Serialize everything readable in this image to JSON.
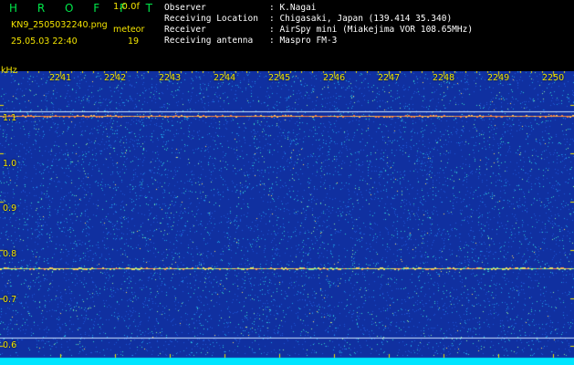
{
  "header": {
    "title": "H R O F F T",
    "version": "1.0.0f",
    "filename": "KN9_2505032240.png",
    "datetime": "25.05.03 22:40",
    "meteor_label": "meteor",
    "meteor_count": "19"
  },
  "info": {
    "rows": [
      {
        "label": "Observer",
        "value": ": K.Nagai"
      },
      {
        "label": "Receiving Location",
        "value": ": Chigasaki, Japan (139.414 35.340)"
      },
      {
        "label": "Receiver",
        "value": ": AirSpy mini (Miakejima VOR 108.65MHz)"
      },
      {
        "label": "Receiving antenna",
        "value": ": Maspro FM-3"
      }
    ]
  },
  "spectrogram": {
    "unit": "kHz",
    "time_ticks": [
      "2241",
      "2242",
      "2243",
      "2244",
      "2245",
      "2246",
      "2247",
      "2248",
      "2249",
      "2250"
    ],
    "freq_ticks": [
      "1.1",
      "1.0",
      "0.9",
      "0.8",
      "0.7",
      "0.6"
    ],
    "ylim": [
      0.58,
      1.17
    ],
    "lines": [
      {
        "freq": 1.087,
        "color": "#cfe6ff"
      },
      {
        "freq": 1.077,
        "color": "#ff9a40"
      },
      {
        "freq": 0.762,
        "color": "#e8e060"
      },
      {
        "freq": 0.618,
        "color": "#cfe6ff"
      }
    ],
    "colors": {
      "background": "#1030a0",
      "baseline": "#00e5ff",
      "text": "#f3e400",
      "title": "#00e84a"
    }
  }
}
